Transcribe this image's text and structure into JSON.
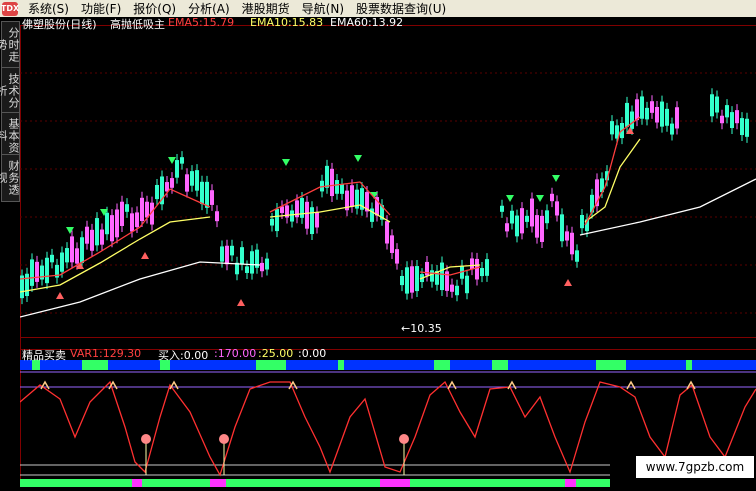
{
  "menu": {
    "logo": "TDX",
    "items": [
      "系统(S)",
      "功能(F)",
      "报价(Q)",
      "分析(A)",
      "港股期货",
      "导航(N)",
      "股票数据查询(U)"
    ]
  },
  "side_tabs": [
    "分时走势",
    "技术分析",
    "基本资料",
    "财务透视"
  ],
  "main_header": {
    "stock": "佛塑股份(日线)",
    "indicator": "高抛低吸主",
    "ema5": "EMA5:15.79",
    "ema10": "EMA10:15.83",
    "ema60": "EMA60:13.92"
  },
  "price_annotation": "←10.35",
  "sub_header": {
    "name": "精品买卖",
    "var1": "VAR1:129.30",
    "buy": "买入:0.00",
    "v170": ":170.00",
    "v25": ":25.00",
    "v0": ":0.00"
  },
  "watermark": "www.7gpzb.com",
  "colors": {
    "ema5": "#ff3d3d",
    "ema10": "#ffff66",
    "ema60": "#ffffff",
    "up_candle": "#ff66ff",
    "down_candle": "#33ffcc",
    "var1_line": "#ff3030",
    "band_blue": "#0033ff",
    "band_green": "#33ff66"
  },
  "chart_data": {
    "type": "candlestick",
    "series": [
      {
        "name": "EMA5",
        "last": 15.79
      },
      {
        "name": "EMA10",
        "last": 15.83
      },
      {
        "name": "EMA60",
        "last": 13.92
      }
    ],
    "annotation_low": 10.35,
    "sub_indicator": {
      "name": "VAR1",
      "last": 129.3,
      "levels": [
        170,
        25,
        0
      ]
    }
  }
}
